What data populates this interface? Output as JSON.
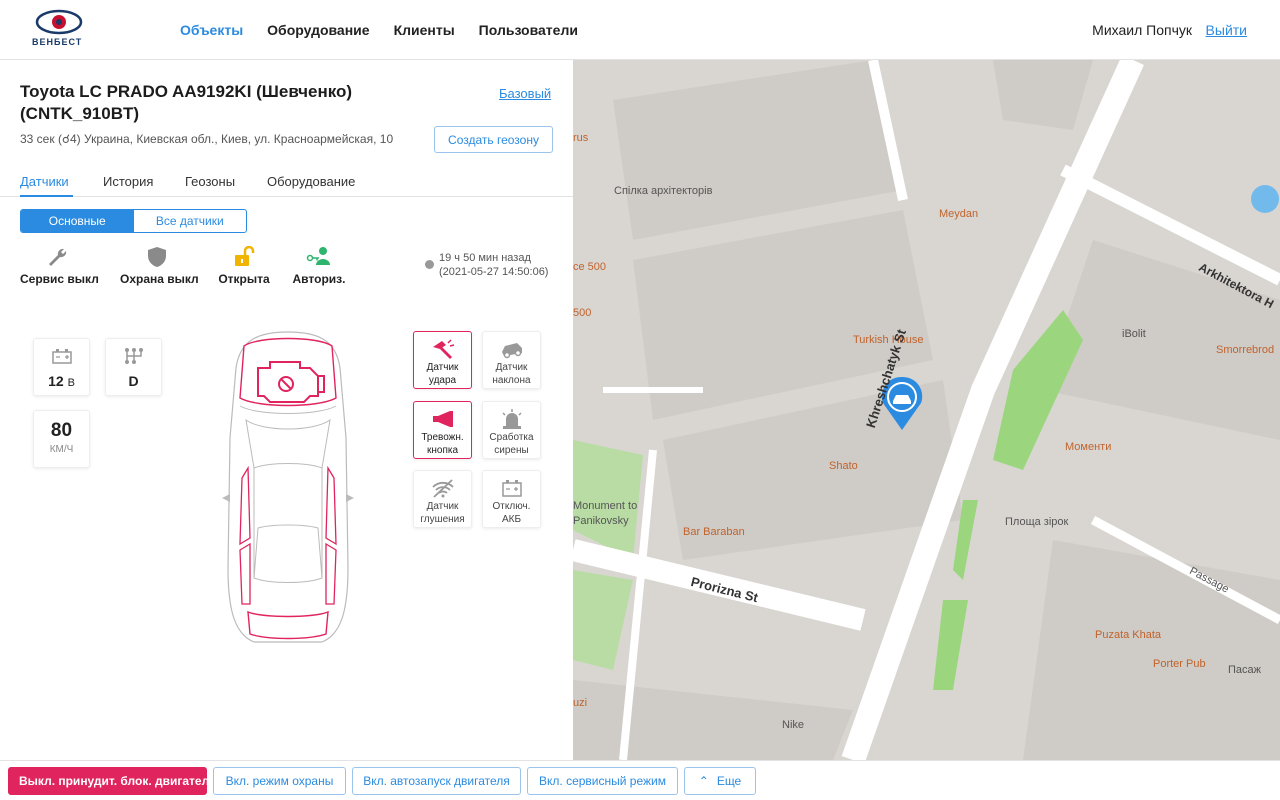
{
  "header": {
    "logo_text": "ВЕНБЕСТ",
    "nav": [
      "Объекты",
      "Оборудование",
      "Клиенты",
      "Пользователи"
    ],
    "user_name": "Михаил Попчук",
    "logout": "Выйти"
  },
  "object": {
    "title": "Toyota LC PRADO AA9192KI (Шевченко) (CNTK_910BT)",
    "plan": "Базовый",
    "address": "33 сек (☌4) Украина, Киевская обл., Киев, ул. Красноармейская, 10",
    "geozone_button": "Создать геозону"
  },
  "tabs": [
    "Датчики",
    "История",
    "Геозоны",
    "Оборудование"
  ],
  "segment": [
    "Основные",
    "Все датчики"
  ],
  "statuses": [
    {
      "label": "Сервис выкл",
      "icon": "wrench-icon"
    },
    {
      "label": "Охрана выкл",
      "icon": "shield-icon"
    },
    {
      "label": "Открыта",
      "icon": "unlocked-padlock-icon"
    },
    {
      "label": "Авториз.",
      "icon": "user-key-icon"
    }
  ],
  "last_seen": {
    "ago": "19 ч 50 мин назад",
    "datetime": "(2021-05-27 14:50:06)"
  },
  "cards": {
    "voltage": {
      "value": "12",
      "unit": "В"
    },
    "gear": {
      "value": "D"
    },
    "speed": {
      "value": "80",
      "unit": "КМ/Ч"
    }
  },
  "sensors": [
    {
      "label1": "Датчик",
      "label2": "удара",
      "alarm": true,
      "icon": "hammer-icon"
    },
    {
      "label1": "Датчик",
      "label2": "наклона",
      "alarm": false,
      "icon": "tilted-car-icon"
    },
    {
      "label1": "Тревожн.",
      "label2": "кнопка",
      "alarm": true,
      "icon": "horn-icon"
    },
    {
      "label1": "Сработка",
      "label2": "сирены",
      "alarm": false,
      "icon": "siren-icon"
    },
    {
      "label1": "Датчик",
      "label2": "глушения",
      "alarm": false,
      "icon": "jamming-icon"
    },
    {
      "label1": "Отключ.",
      "label2": "АКБ",
      "alarm": false,
      "icon": "battery-icon"
    }
  ],
  "map_labels": {
    "architects": "Спілка архітекторів",
    "meydan": "Meydan",
    "turkish": "Turkish House",
    "shato": "Shato",
    "street": "Khreshchatyk St",
    "prorizna": "Prorizna St",
    "arkhitektora": "Arkhitektora H",
    "ibolit": "iBolit",
    "smorrebrod": "Smorrebrod",
    "momenty": "Моменти",
    "ploshcha": "Площа зірок",
    "passage": "Passage",
    "puzata": "Puzata Khata",
    "porter": "Porter Pub",
    "pasazh": "Пасаж",
    "nike": "Nike",
    "barbaran": "Bar Baraban",
    "monument1": "Monument to",
    "monument2": "Panikovsky",
    "rus": "rus",
    "ce500a": "ce 500",
    "ce500b": "500",
    "uzi": "uzi"
  },
  "actions": [
    "Выкл. принудит. блок. двигателя",
    "Вкл. режим охраны",
    "Вкл. автозапуск двигателя",
    "Вкл. сервисный режим",
    "Еще"
  ],
  "colors": {
    "accent": "#2b8be0",
    "alarm": "#e0245e"
  }
}
